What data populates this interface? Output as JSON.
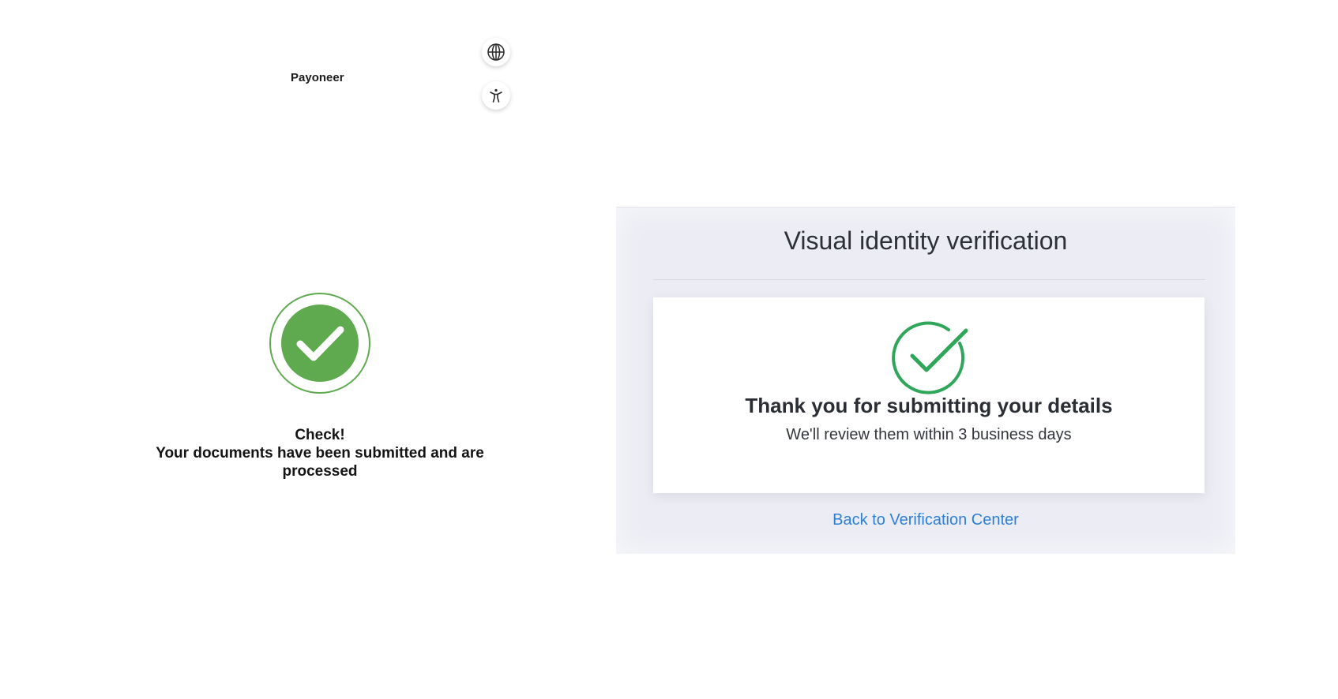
{
  "header": {
    "brand": "Payoneer",
    "icons": {
      "language": "globe-icon",
      "accessibility": "accessibility-icon"
    }
  },
  "left_panel": {
    "status_icon": "check-circle-icon",
    "title": "Check!",
    "message": "Your documents have been submitted and are processed",
    "accent_color": "#5faa4e"
  },
  "verification_panel": {
    "title": "Visual identity verification",
    "card": {
      "icon": "check-circle-outline-icon",
      "heading": "Thank you for submitting your details",
      "subheading": "We'll review them within 3 business days",
      "accent_color": "#2fa65a"
    },
    "back_link": "Back to Verification Center",
    "link_color": "#2d7fd6"
  }
}
